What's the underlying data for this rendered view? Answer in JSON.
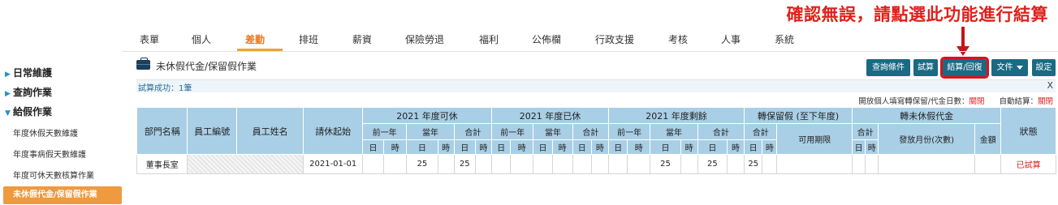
{
  "annotation": {
    "text": "確認無誤，請點選此功能進行結算"
  },
  "topnav": [
    "表單",
    "個人",
    "差勤",
    "排班",
    "薪資",
    "保險勞退",
    "福利",
    "公佈欄",
    "行政支援",
    "考核",
    "人事",
    "系統"
  ],
  "topnav_active": "差勤",
  "sidebar": {
    "groups": [
      {
        "label": "日常維護",
        "expanded": false
      },
      {
        "label": "查詢作業",
        "expanded": false
      },
      {
        "label": "給假作業",
        "expanded": true
      }
    ],
    "subitems": [
      "年度休假天數維護",
      "年度事病假天數維護",
      "年度可休天數核算作業"
    ],
    "active_item": "未休假代金/保留假作業"
  },
  "page": {
    "title": "未休假代金/保留假作業"
  },
  "toolbar": {
    "query": "查詢條件",
    "trial": "試算",
    "settle": "結算/回復",
    "doc": "文件",
    "settings": "設定"
  },
  "message": {
    "text": "試算成功：1筆",
    "close": "X"
  },
  "options": {
    "open_label": "開放個人填寫轉保留/代金日數：",
    "open_value": "關閉",
    "auto_label": "自動結算：",
    "auto_value": "關閉"
  },
  "table": {
    "headers": {
      "dept": "部門名稱",
      "emp_no": "員工編號",
      "emp_name": "員工姓名",
      "start": "請休起始",
      "avail": "2021 年度可休",
      "taken": "2021 年度已休",
      "remain": "2021 年度剩餘",
      "retain": "轉保留假 (至下年度)",
      "cash": "轉未休假代金",
      "status": "狀態",
      "prev_year": "前一年",
      "curr_year": "當年",
      "total": "合計",
      "valid": "可用期限",
      "pay_month": "發放月份(次數)",
      "amount": "金額",
      "day": "日",
      "hour": "時"
    },
    "rows": [
      {
        "dept": "董事長室",
        "emp_no": "",
        "emp_name": "",
        "start": "2021-01-01",
        "avail_prev_d": "",
        "avail_prev_h": "",
        "avail_curr_d": "25",
        "avail_curr_h": "",
        "avail_tot_d": "25",
        "avail_tot_h": "",
        "taken_prev_d": "",
        "taken_prev_h": "",
        "taken_curr_d": "",
        "taken_curr_h": "",
        "taken_tot_d": "",
        "taken_tot_h": "",
        "remain_prev_d": "",
        "remain_prev_h": "",
        "remain_curr_d": "25",
        "remain_curr_h": "",
        "remain_tot_d": "25",
        "remain_tot_h": "",
        "retain_tot_d": "25",
        "retain_tot_h": "",
        "retain_valid": "",
        "cash_tot_d": "",
        "cash_tot_h": "",
        "cash_month": "",
        "cash_amount": "",
        "status": "已試算"
      }
    ]
  },
  "colors": {
    "accent_orange": "#ef9a3e",
    "button_teal": "#1a6a84",
    "header_blue": "#a9cfe6",
    "highlight_red": "#d9121a"
  }
}
